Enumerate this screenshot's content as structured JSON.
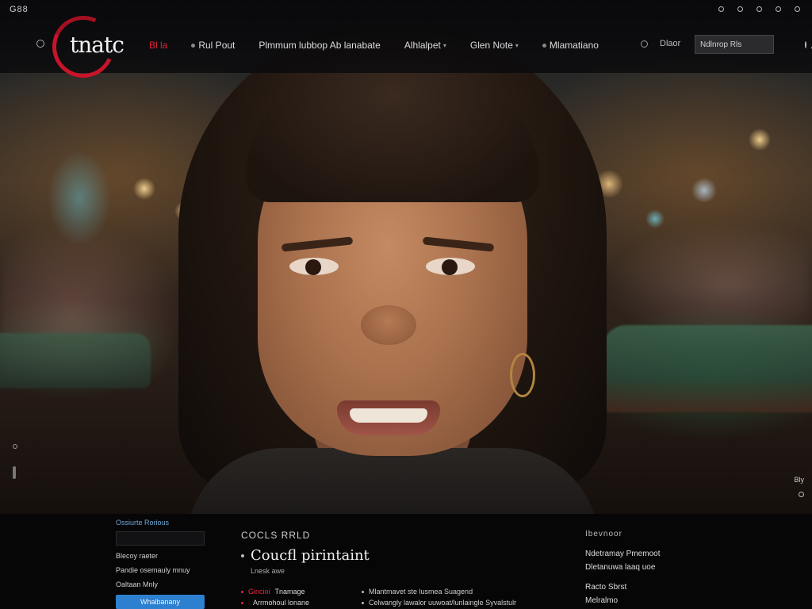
{
  "topbar": {
    "language": "G88",
    "utilities": [
      "",
      "",
      "",
      "",
      ""
    ]
  },
  "header": {
    "logo_text": "tnatc",
    "logo_tagline": "",
    "nav": [
      {
        "label": "Bl la",
        "active": true
      },
      {
        "label": "Rul Pout",
        "active": false
      },
      {
        "label": "Plmmum lubbop Ab lanabate",
        "active": false
      },
      {
        "label": "Alhlalpet",
        "active": false
      },
      {
        "label": "Glen Note",
        "active": false
      },
      {
        "label": "Mlamatiano",
        "active": false
      }
    ],
    "link": "Dlaor",
    "search_placeholder": "Ndlnrop Rls"
  },
  "hero": {
    "side_text": "Bly"
  },
  "footer": {
    "signup": {
      "title": "Ossiurte Rorious",
      "input_placeholder": "",
      "lines": [
        "Blecoy raeter",
        "Pandie osemauly mnuy",
        "Oaltaan Mnly"
      ],
      "button": "Whalbanany"
    },
    "feature": {
      "kicker": "COCLS RRLD",
      "title": "Coucfl pirintaint",
      "subtitle": "Lnesk awe",
      "rows": [
        {
          "c1_red": "Gincioi",
          "c1": "Tnamage",
          "c2": "Mlantmavet ste lusmea Suagend"
        },
        {
          "c1_red": "",
          "c1": "Arrmohoul lonane",
          "c2": "Celwangly lawalor uuwoat/lunlaingle Syvalstulr"
        }
      ]
    },
    "links": {
      "heading": "Ibevnoor",
      "items": [
        "Ndetramay Pmemoot",
        "Dletanuwa laaq uoe",
        "Racto Sbrst",
        "Melralmo"
      ]
    }
  }
}
